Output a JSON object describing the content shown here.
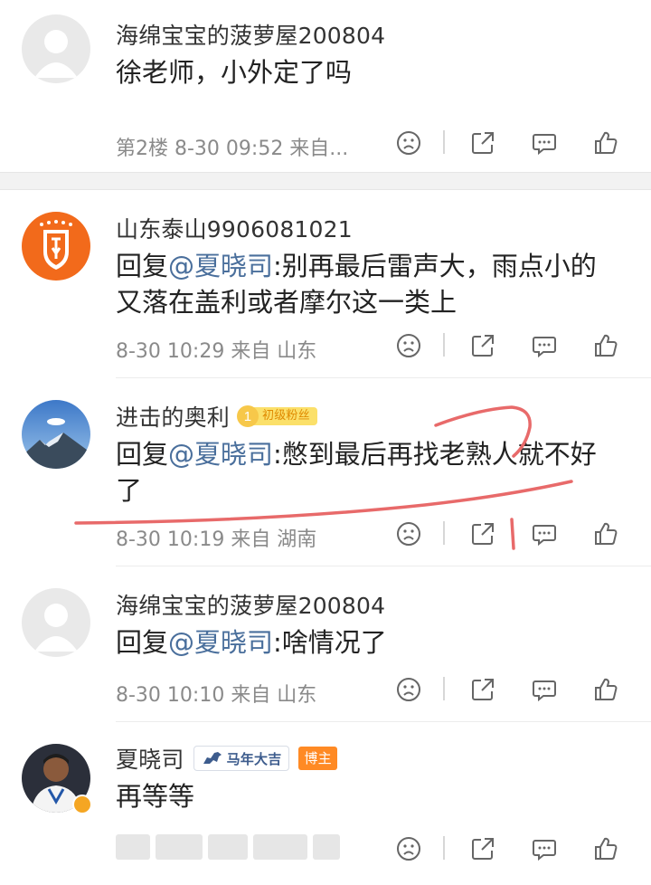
{
  "comments": [
    {
      "username": "海绵宝宝的菠萝屋200804",
      "text": "徐老师，小外定了吗",
      "meta": "第2楼 8-30 09:52 来自..."
    },
    {
      "username": "山东泰山9906081021",
      "reply_prefix": "回复",
      "mention": "@夏晓司",
      "text": ":别再最后雷声大，雨点小的又落在盖利或者摩尔这一类上",
      "meta": "8-30 10:29 来自 山东"
    },
    {
      "username": "进击的奥利",
      "fan_level": "1",
      "fan_label": "初级粉丝",
      "reply_prefix": "回复",
      "mention": "@夏晓司",
      "text": ":憋到最后再找老熟人就不好了",
      "meta": "8-30 10:19 来自 湖南"
    },
    {
      "username": "海绵宝宝的菠萝屋200804",
      "reply_prefix": "回复",
      "mention": "@夏晓司",
      "text": ":啥情况了",
      "meta": "8-30 10:10 来自 山东"
    },
    {
      "username": "夏晓司",
      "event_badge": "马年大吉",
      "host_badge": "博主",
      "text": "再等等",
      "meta": ""
    }
  ],
  "icons": {
    "dislike": "sad-face-icon",
    "share": "share-icon",
    "comment": "comment-icon",
    "like": "thumbs-up-icon"
  },
  "colors": {
    "mention": "#4a6f9c",
    "meta": "#8a8a8a",
    "scribble": "#e86a6a",
    "host_badge": "#ff8a24"
  }
}
